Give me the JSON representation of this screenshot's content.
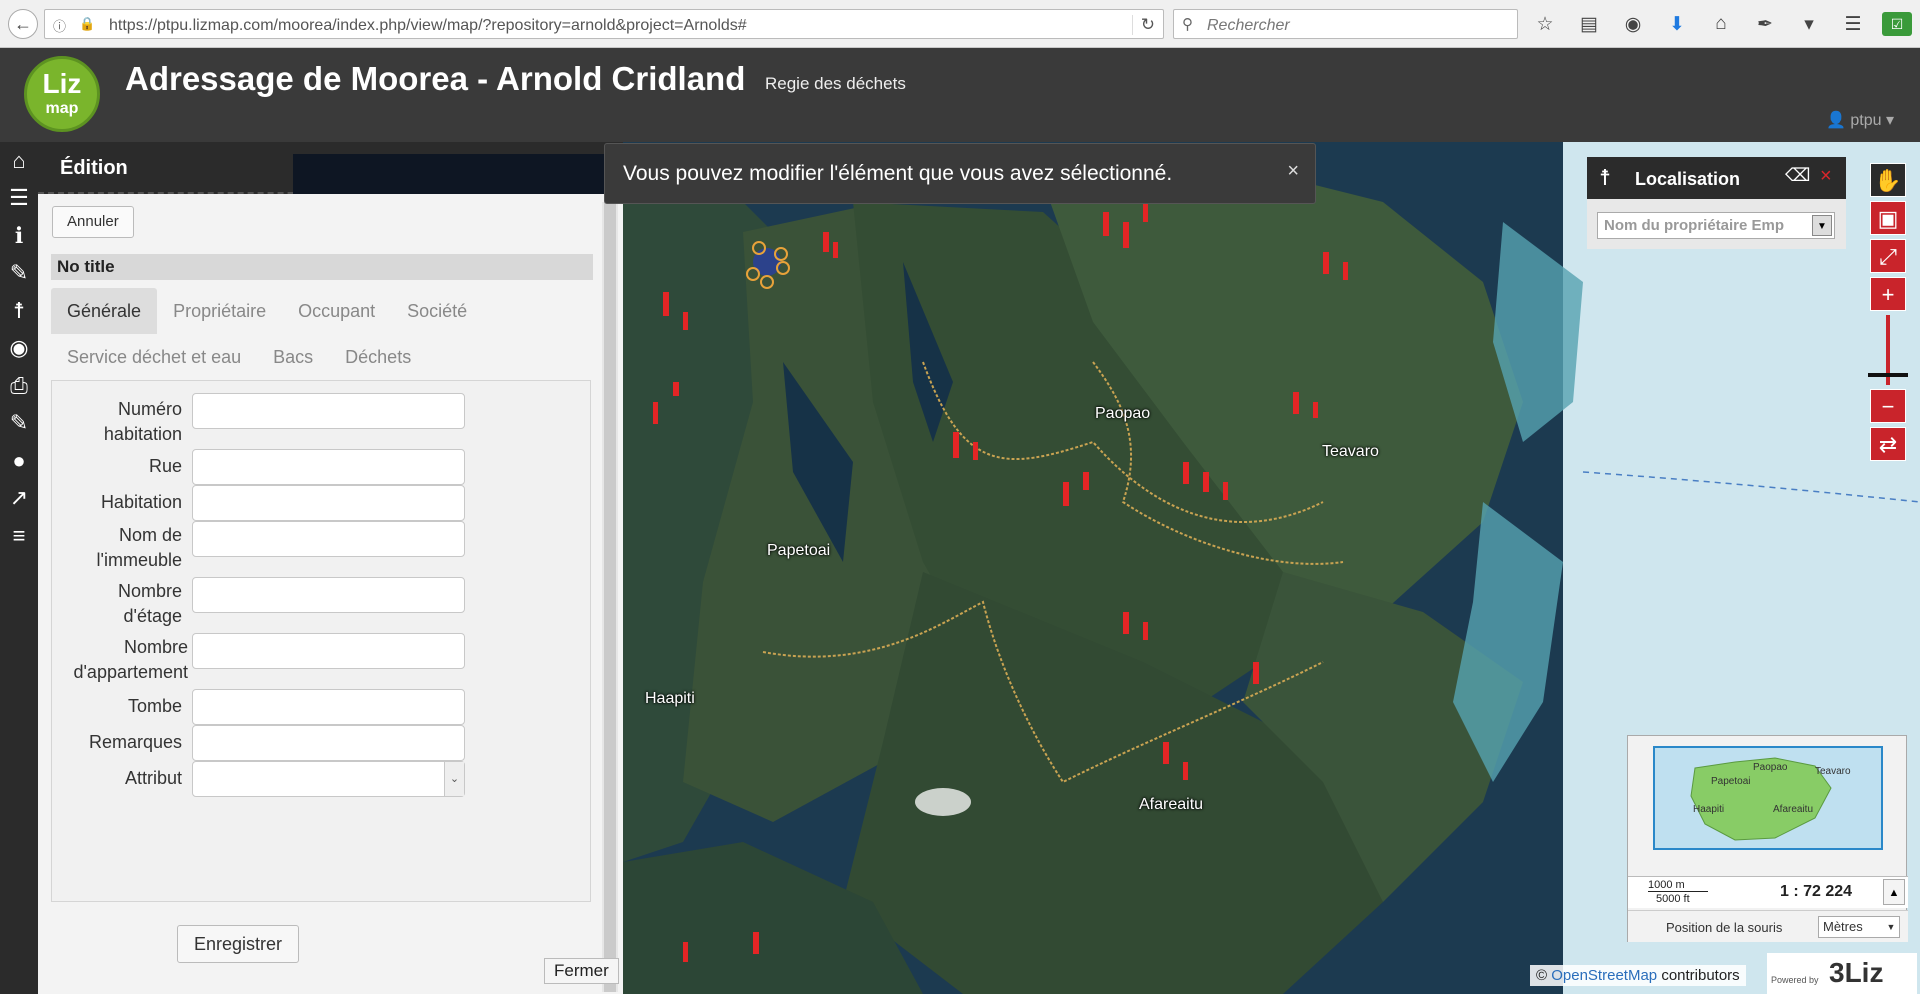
{
  "browser": {
    "url": "https://ptpu.lizmap.com/moorea/index.php/view/map/?repository=arnold&project=Arnolds#",
    "search_placeholder": "Rechercher"
  },
  "header": {
    "logo_top": "Liz",
    "logo_bottom": "map",
    "title": "Adressage de Moorea - Arnold Cridland",
    "subtitle": "Regie des déchets",
    "user": "ptpu"
  },
  "edition": {
    "title": "Édition",
    "cancel_label": "Annuler",
    "form_title": "No title",
    "tabs_row1": [
      "Générale",
      "Propriétaire",
      "Occupant",
      "Société"
    ],
    "tabs_row2": [
      "Service déchet et eau",
      "Bacs",
      "Déchets"
    ],
    "fields": [
      {
        "label_line1": "Numéro",
        "label_line2": "habitation"
      },
      {
        "label_line1": "Rue",
        "label_line2": ""
      },
      {
        "label_line1": "Habitation",
        "label_line2": ""
      },
      {
        "label_line1": "Nom de",
        "label_line2": "l'immeuble"
      },
      {
        "label_line1": "Nombre",
        "label_line2": "d'étage"
      },
      {
        "label_line1": "Nombre",
        "label_line2": "d'appartement"
      },
      {
        "label_line1": "Tombe",
        "label_line2": ""
      },
      {
        "label_line1": "Remarques",
        "label_line2": ""
      },
      {
        "label_line1": "Attribut",
        "label_line2": ""
      }
    ],
    "save_label": "Enregistrer",
    "close_label": "Fermer",
    "dock_close": "×"
  },
  "alert": {
    "message": "Vous pouvez modifier l'élément que vous avez sélectionné.",
    "close": "×"
  },
  "localisation": {
    "title": "Localisation",
    "placeholder": "Nom du propriétaire Emp",
    "close": "×"
  },
  "map": {
    "places": [
      "Paopao",
      "Teavaro",
      "Papetoai",
      "Haapiti",
      "Afareaitu"
    ],
    "accent_color": "#c9242b"
  },
  "overview": {
    "places": [
      "Paopao",
      "Teavaro",
      "Papetoai",
      "Haapiti",
      "Afareaitu"
    ],
    "scale_metric": "1000 m",
    "scale_imperial": "5000 ft",
    "scale_value": "1 : 72 224",
    "mouse_label": "Position de la souris",
    "unit": "Mètres"
  },
  "attribution": {
    "prefix": "©",
    "link": "OpenStreetMap",
    "suffix": "contributors",
    "powered": "Powered by",
    "brand": "3Liz"
  }
}
